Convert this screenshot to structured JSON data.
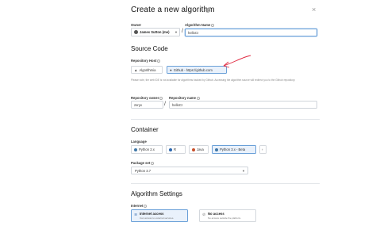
{
  "dialog": {
    "title": "Create a new algorithm",
    "close_label": "×",
    "help_label": "?"
  },
  "owner": {
    "label": "Owner",
    "value": "James Sutton (me)"
  },
  "algorithm_name": {
    "label": "Algorithm Name",
    "value": "helloCI"
  },
  "source_code": {
    "heading": "Source Code",
    "repository_host_label": "Repository Host",
    "hosts": [
      {
        "label": "Algorithmia",
        "icon": "algorithmia-icon",
        "active": false
      },
      {
        "label": "Github - https://github.com",
        "icon": "github-icon",
        "active": true
      }
    ],
    "hint": "Please note, the web IDE is not available for algorithms backed by Github. Accessing the algorithm source will redirect you to the Github repository.",
    "repository_owner_label": "Repository owner",
    "repository_owner_value": "zeryx",
    "repository_name_label": "Repository name",
    "repository_name_value": "helloCI"
  },
  "container": {
    "heading": "Container",
    "language_label": "Language",
    "languages": [
      {
        "label": "Python 2.x",
        "active": false
      },
      {
        "label": "R",
        "active": false
      },
      {
        "label": "Java",
        "active": false
      },
      {
        "label": "Python 3.x - Beta",
        "active": true
      }
    ],
    "more_label": "›",
    "package_set_label": "Package set",
    "package_set_value": "Python 3.7"
  },
  "settings": {
    "heading": "Algorithm Settings",
    "internet_label": "Internet",
    "options": [
      {
        "title": "Internet access",
        "desc": "Can access to external services.",
        "active": true
      },
      {
        "title": "No access",
        "desc": "No access outside the platform.",
        "active": false
      }
    ]
  },
  "colors": {
    "accent": "#6aa0d8",
    "accent_bg": "#e9f1fb",
    "annotation_arrow": "#e0243c"
  }
}
